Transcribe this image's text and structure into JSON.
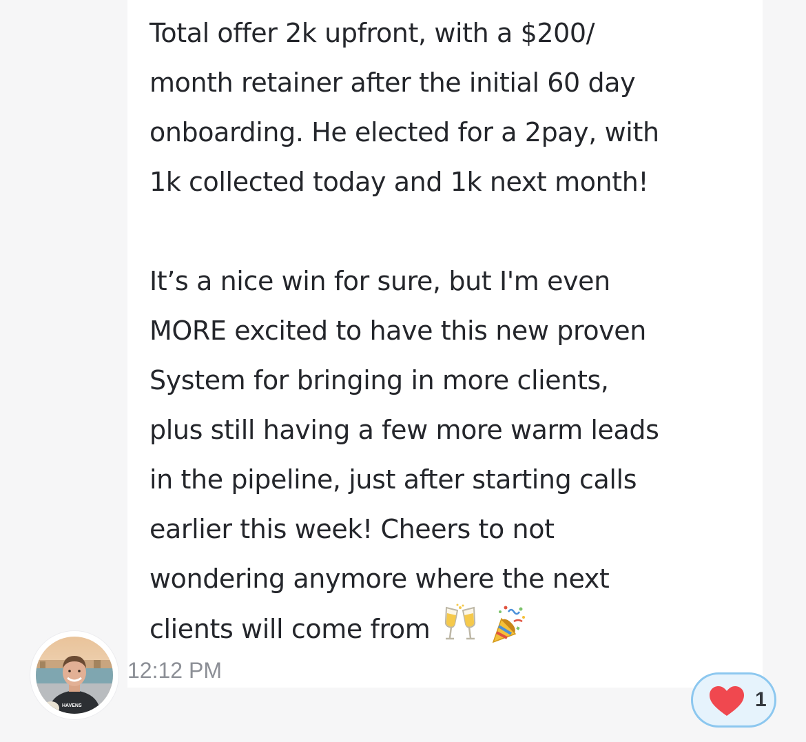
{
  "message": {
    "lines": [
      "Total offer 2k upfront, with a $200/",
      "month retainer after the initial 60 day",
      "onboarding. He elected for a 2pay, with",
      "1k collected today and 1k next month!",
      "",
      "It’s a nice win for sure, but I'm even",
      "MORE excited to have this new proven",
      "System for bringing in more clients,",
      "plus still having a few more warm leads",
      "in the pipeline, just after starting calls",
      "earlier this week! Cheers to not",
      "wondering anymore where the next",
      "clients will come from"
    ],
    "emojis": [
      "champagne-glasses-icon",
      "party-popper-icon"
    ],
    "timestamp": "12:12 PM"
  },
  "avatar": {
    "shirt_text": "HAVENS"
  },
  "reaction": {
    "icon": "heart-icon",
    "count": "1",
    "heart_color": "#f0484f",
    "border_color": "#8cc7ef",
    "background": "#e6f3fc"
  }
}
